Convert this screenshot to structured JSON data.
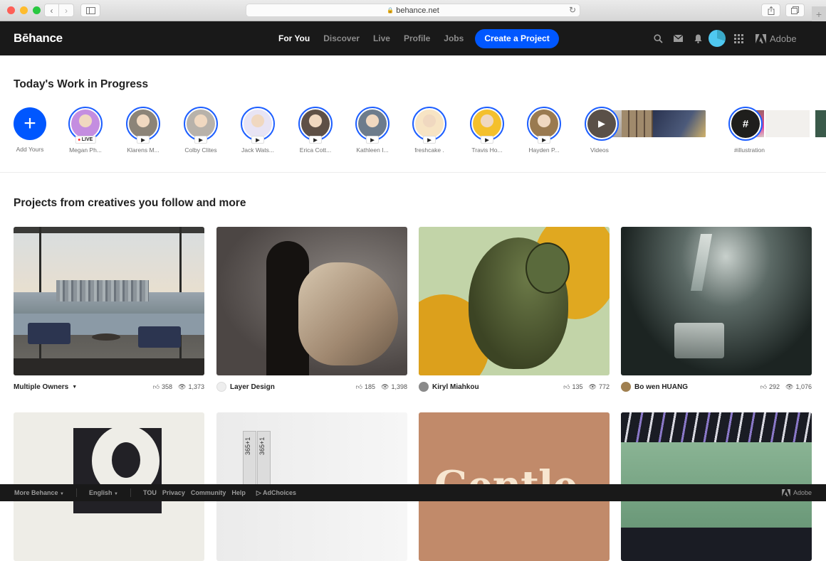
{
  "browser": {
    "url": "behance.net"
  },
  "nav": {
    "logo": "Bēhance",
    "links": [
      {
        "label": "For You",
        "active": true
      },
      {
        "label": "Discover",
        "active": false
      },
      {
        "label": "Live",
        "active": false
      },
      {
        "label": "Profile",
        "active": false
      },
      {
        "label": "Jobs",
        "active": false
      }
    ],
    "create_button": "Create a Project",
    "adobe_label": "Adobe"
  },
  "wip": {
    "title": "Today's Work in Progress",
    "add_label": "Add Yours",
    "items": [
      {
        "label": "Megan Ph...",
        "badge": "LIVE",
        "color": "#c48de0"
      },
      {
        "label": "Klarens M...",
        "badge": "play",
        "color": "#8c8478"
      },
      {
        "label": "Colby Clites",
        "badge": "play",
        "color": "#b8b2aa"
      },
      {
        "label": "Jack Wats...",
        "badge": "play",
        "color": "#e8e4f4"
      },
      {
        "label": "Erica Cott...",
        "badge": "play",
        "color": "#5e5046"
      },
      {
        "label": "Kathleen I...",
        "badge": "play",
        "color": "#6d7c8c"
      },
      {
        "label": "freshcake .",
        "badge": "play",
        "color": "#f7e4c4"
      },
      {
        "label": "Travis Ho...",
        "badge": "play",
        "color": "#f4c02c"
      },
      {
        "label": "Hayden P...",
        "badge": "play",
        "color": "#9a7a50"
      }
    ],
    "collections": [
      {
        "label": "Videos",
        "icon": "play"
      },
      {
        "label": "#illustration",
        "icon": "#"
      }
    ]
  },
  "projects": {
    "title": "Projects from creatives you follow and more",
    "cards": [
      {
        "owner": "Multiple Owners",
        "dropdown": true,
        "likes": "358",
        "views": "1,373",
        "avatar_color": ""
      },
      {
        "owner": "Layer Design",
        "dropdown": false,
        "likes": "185",
        "views": "1,398",
        "avatar_color": "#e8e8e8"
      },
      {
        "owner": "Kiryl Miahkou",
        "dropdown": false,
        "likes": "135",
        "views": "772",
        "avatar_color": "#8a8a8a"
      },
      {
        "owner": "Bo wen HUANG",
        "dropdown": false,
        "likes": "292",
        "views": "1,076",
        "avatar_color": "#a08050"
      }
    ],
    "row2_texts": {
      "book_label": "365+1",
      "gentle_word": "Gentle"
    }
  },
  "footer": {
    "more": "More Behance",
    "language": "English",
    "links": [
      "TOU",
      "Privacy",
      "Community",
      "Help"
    ],
    "adchoices": "AdChoices",
    "adobe": "Adobe"
  }
}
